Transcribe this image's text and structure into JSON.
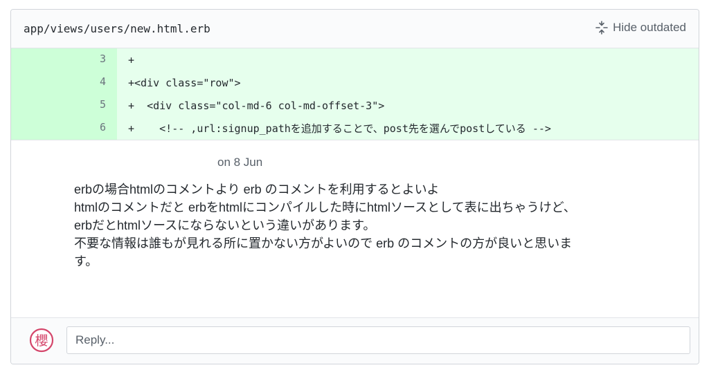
{
  "file": {
    "path": "app/views/users/new.html.erb",
    "hide_outdated_label": "Hide outdated"
  },
  "diff": {
    "lines": [
      {
        "number": "3",
        "code": "+"
      },
      {
        "number": "4",
        "code": "+<div class=\"row\">"
      },
      {
        "number": "5",
        "code": "+  <div class=\"col-md-6 col-md-offset-3\">"
      },
      {
        "number": "6",
        "code": "+    <!-- ,url:signup_pathを追加することで、post先を選んでpostしている -->"
      }
    ]
  },
  "comment": {
    "date": "on 8 Jun",
    "lines": [
      "erbの場合htmlのコメントより erb のコメントを利用するとよいよ",
      "htmlのコメントだと erbをhtmlにコンパイルした時にhtmlソースとして表に出ちゃうけど、",
      "erbだとhtmlソースにならないという違いがあります。",
      "不要な情報は誰もが見れる所に置かない方がよいので erb のコメントの方が良いと思いま",
      "す。"
    ]
  },
  "reply": {
    "placeholder": "Reply...",
    "avatar_glyph": "櫻",
    "avatar_color": "#d4456a"
  },
  "icons": {
    "hide_outdated": "fold-icon",
    "avatar": "user-avatar"
  }
}
